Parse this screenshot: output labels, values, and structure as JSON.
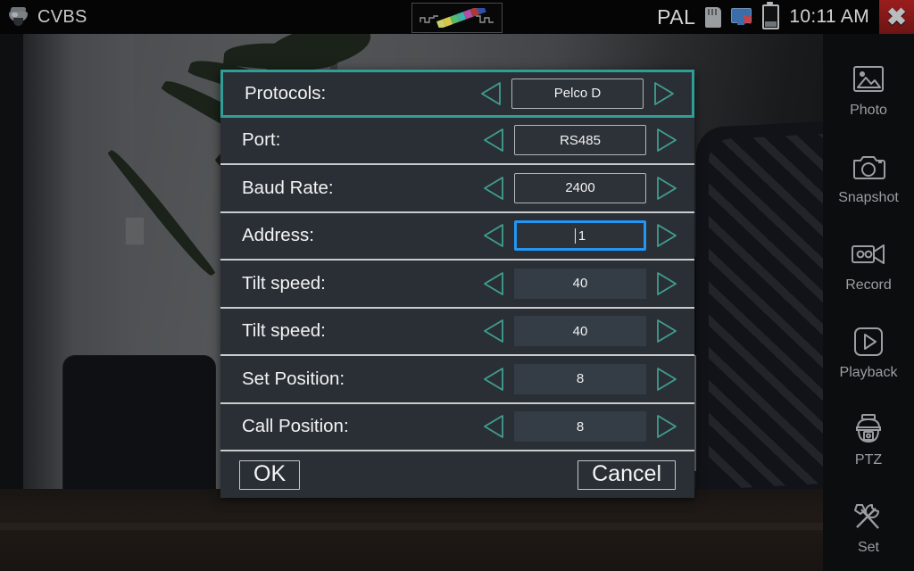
{
  "statusbar": {
    "camera_icon": "dome-camera-icon",
    "title": "CVBS",
    "center_icon": "color-bar-waveform-icon",
    "signal_format": "PAL",
    "sdcard_icon": "sdcard-icon",
    "network_icon": "network-disconnected-icon",
    "battery_icon": "battery-icon",
    "clock": "10:11 AM",
    "close_label": "✖",
    "close_icon": "close-icon",
    "accent_red": "#8c1b1b"
  },
  "dialog": {
    "accent_teal": "#2f9e96",
    "focus_blue": "#2196f3",
    "rows": [
      {
        "label": "Protocols:",
        "value": "Pelco D",
        "style": "bordered",
        "selected": true,
        "focused": false
      },
      {
        "label": "Port:",
        "value": "RS485",
        "style": "bordered",
        "selected": false,
        "focused": false
      },
      {
        "label": "Baud Rate:",
        "value": "2400",
        "style": "bordered",
        "selected": false,
        "focused": false
      },
      {
        "label": "Address:",
        "value": "1",
        "style": "focus",
        "selected": false,
        "focused": true
      },
      {
        "label": "Tilt speed:",
        "value": "40",
        "style": "plain",
        "selected": false,
        "focused": false
      },
      {
        "label": "Tilt speed:",
        "value": "40",
        "style": "plain",
        "selected": false,
        "focused": false
      },
      {
        "label": "Set Position:",
        "value": "8",
        "style": "plain",
        "selected": false,
        "focused": false
      },
      {
        "label": "Call Position:",
        "value": "8",
        "style": "plain",
        "selected": false,
        "focused": false
      }
    ],
    "prev_icon": "arrow-left-icon",
    "next_icon": "arrow-right-icon",
    "ok_label": "OK",
    "cancel_label": "Cancel"
  },
  "sidebar": {
    "items": [
      {
        "label": "Photo",
        "icon": "photo-icon"
      },
      {
        "label": "Snapshot",
        "icon": "camera-icon"
      },
      {
        "label": "Record",
        "icon": "video-camera-icon"
      },
      {
        "label": "Playback",
        "icon": "play-icon"
      },
      {
        "label": "PTZ",
        "icon": "ptz-dome-icon"
      },
      {
        "label": "Set",
        "icon": "tools-icon"
      }
    ]
  }
}
